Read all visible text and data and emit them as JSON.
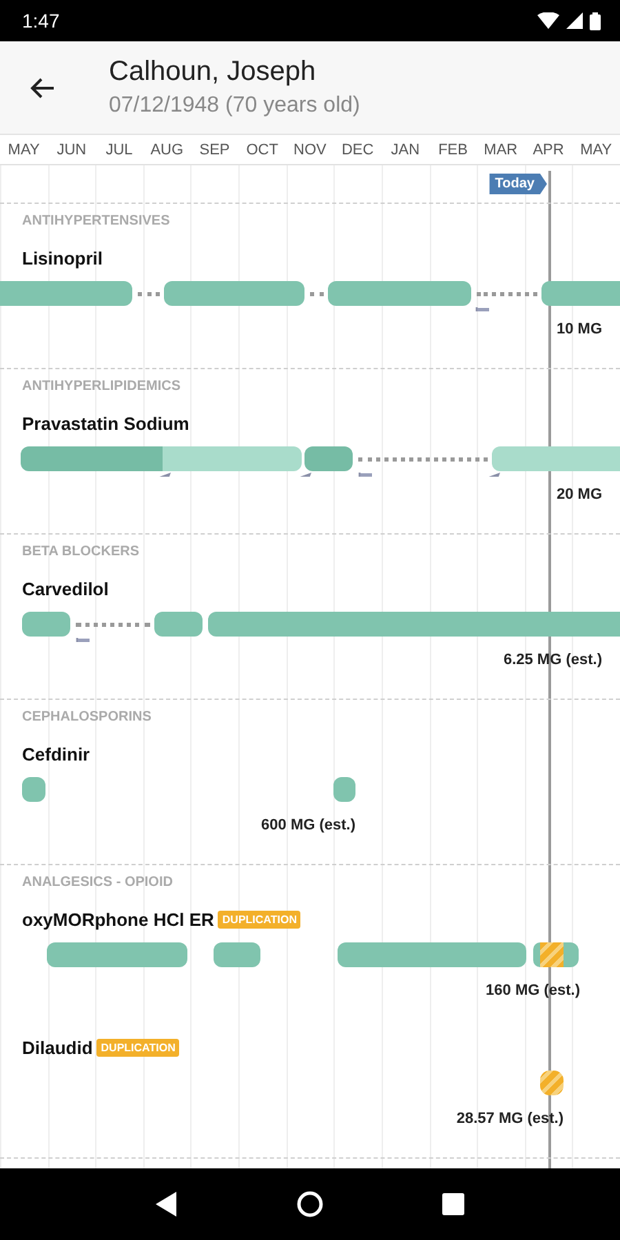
{
  "status_bar": {
    "time": "1:47"
  },
  "header": {
    "title": "Calhoun, Joseph",
    "subtitle": "07/12/1948 (70 years old)"
  },
  "timeline": {
    "months": [
      "MAY",
      "JUN",
      "JUL",
      "AUG",
      "SEP",
      "OCT",
      "NOV",
      "DEC",
      "JAN",
      "FEB",
      "MAR",
      "APR",
      "MAY"
    ],
    "today": {
      "label": "Today"
    },
    "groups": [
      {
        "category": "ANTIHYPERTENSIVES",
        "drugs": [
          {
            "name": "Lisinopril",
            "dose": "10 MG"
          }
        ]
      },
      {
        "category": "ANTIHYPERLIPIDEMICS",
        "drugs": [
          {
            "name": "Pravastatin Sodium",
            "dose": "20 MG"
          }
        ]
      },
      {
        "category": "BETA BLOCKERS",
        "drugs": [
          {
            "name": "Carvedilol",
            "dose": "6.25 MG (est.)"
          }
        ]
      },
      {
        "category": "CEPHALOSPORINS",
        "drugs": [
          {
            "name": "Cefdinir",
            "dose": "600 MG (est.)"
          }
        ]
      },
      {
        "category": "ANALGESICS - OPIOID",
        "drugs": [
          {
            "name": "oxyMORphone HCl ER",
            "badge": "DUPLICATION",
            "dose": "160 MG (est.)"
          },
          {
            "name": "Dilaudid",
            "badge": "DUPLICATION",
            "dose": "28.57 MG (est.)"
          }
        ]
      }
    ]
  }
}
